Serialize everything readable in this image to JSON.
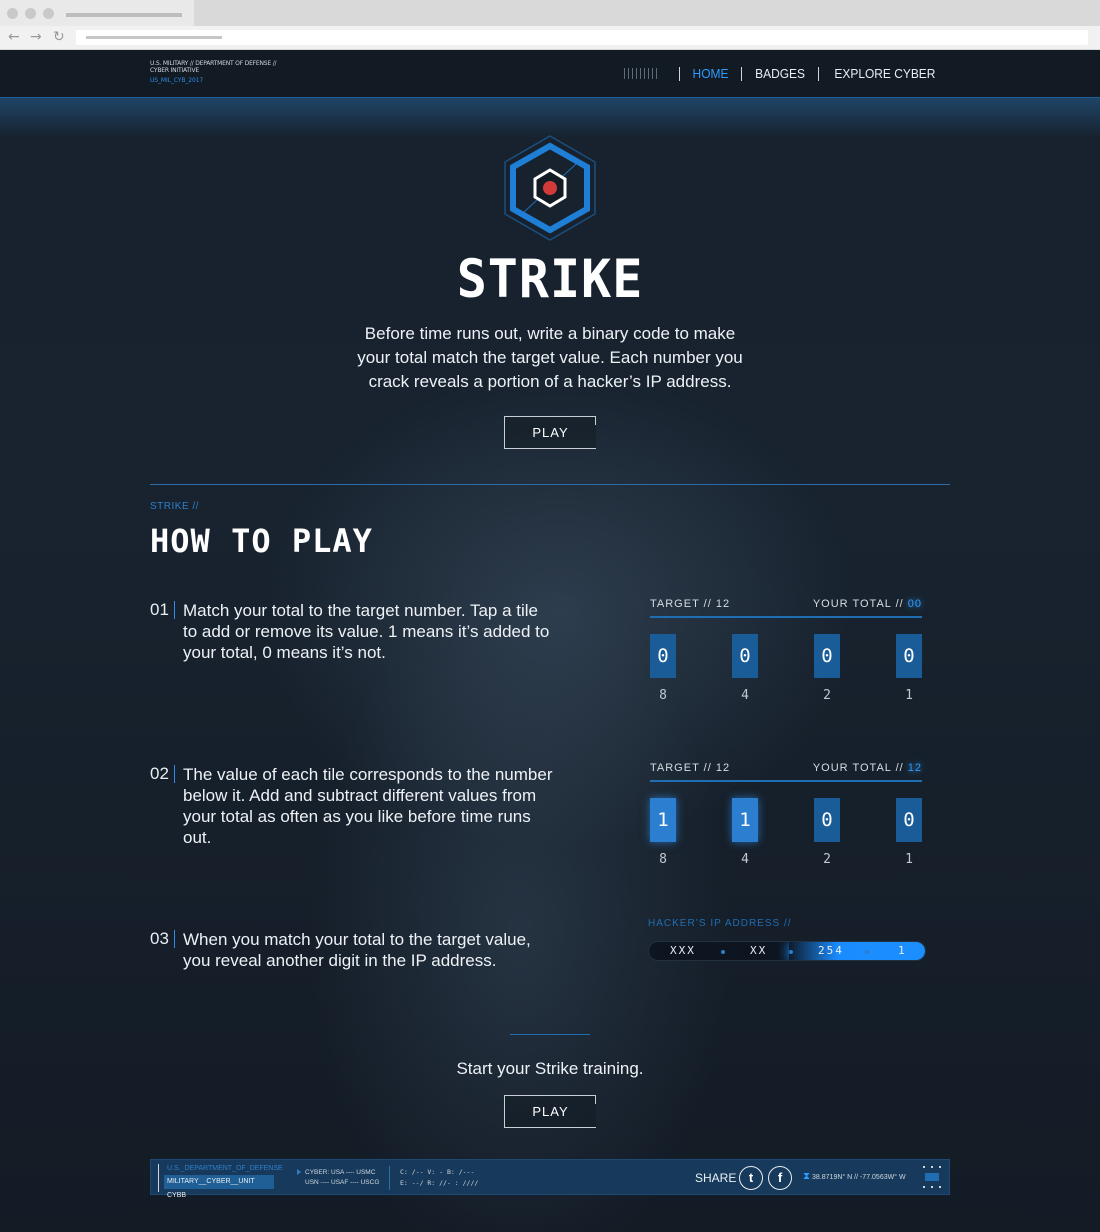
{
  "nav": {
    "brand_line1": "U.S. MILITARY // DEPARTMENT OF DEFENSE // CYBER INITIATIVE",
    "brand_line2": "US_MIL_CYB_2017",
    "items": [
      {
        "label": "HOME"
      },
      {
        "label": "BADGES"
      },
      {
        "label": "EXPLORE CYBER"
      }
    ]
  },
  "hero": {
    "title": "STRIKE",
    "description": "Before time runs out, write a binary code to make your total match the target value. Each number you crack reveals a portion of a hacker’s IP address.",
    "play_label": "PLAY"
  },
  "howto": {
    "crumb": "STRIKE //",
    "title": "HOW TO PLAY",
    "steps": [
      {
        "num": "01",
        "text": "Match your total to the target number. Tap a tile to add or remove its value. 1 means it’s added to your total, 0 means it’s not."
      },
      {
        "num": "02",
        "text": "The value of each tile corresponds to the number below it. Add and subtract different values from your total as often as you like before time runs out."
      },
      {
        "num": "03",
        "text": "When you match your total to the target value, you reveal another digit in the IP address."
      }
    ]
  },
  "panels": [
    {
      "target_label": "TARGET  //  12",
      "total_label": "YOUR TOTAL  //",
      "total_value": "00",
      "tiles": [
        {
          "bit": "0",
          "value": "8"
        },
        {
          "bit": "0",
          "value": "4"
        },
        {
          "bit": "0",
          "value": "2"
        },
        {
          "bit": "0",
          "value": "1"
        }
      ]
    },
    {
      "target_label": "TARGET  //  12",
      "total_label": "YOUR TOTAL  //",
      "total_value": "12",
      "tiles": [
        {
          "bit": "1",
          "value": "8"
        },
        {
          "bit": "1",
          "value": "4"
        },
        {
          "bit": "0",
          "value": "2"
        },
        {
          "bit": "0",
          "value": "1"
        }
      ]
    }
  ],
  "ip": {
    "label": "HACKER’S IP ADDRESS  //",
    "segments": [
      "XXX",
      "XX",
      "254",
      "1"
    ]
  },
  "cta": {
    "text": "Start your Strike training.",
    "play_label": "PLAY"
  },
  "footer": {
    "dept": "U.S._DEPARTMENT_OF_DEFENSE",
    "unit": "MILITARY__CYBER__UNIT CYBB",
    "cyber_line1": "CYBER: USA ---- USMC",
    "cyber_line2": "USN ---- USAF ---- USCG",
    "codes_line1": "C: /--   V: -     B: /---",
    "codes_line2": "E: --/   R: //-   :  ////",
    "share_label": "SHARE",
    "twitter_glyph": "t",
    "facebook_glyph": "f",
    "coords": "38.8719N° N // -77.0563W° W"
  },
  "colors": {
    "accent": "#2e9bff",
    "tile": "#1a5c98",
    "background": "#121a24"
  }
}
